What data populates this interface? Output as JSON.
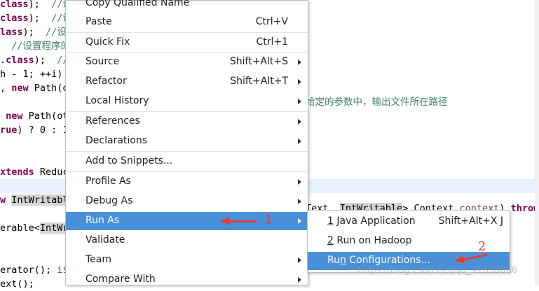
{
  "editor": {
    "lines": [
      [
        {
          "t": "class",
          "c": "kw"
        },
        {
          "t": ");  "
        },
        {
          "t": "//设",
          "c": "cm"
        }
      ],
      [
        {
          "t": "class",
          "c": "kw"
        },
        {
          "t": ");  "
        },
        {
          "t": "//设",
          "c": "cm"
        }
      ],
      [
        {
          "t": "lass",
          "c": "kw"
        },
        {
          "t": ");  "
        },
        {
          "t": "//设",
          "c": "cm"
        }
      ],
      [
        {
          "t": "  "
        },
        {
          "t": "//设置程序的输",
          "c": "cm"
        }
      ],
      [
        {
          "t": "."
        },
        {
          "t": "class",
          "c": "kw"
        },
        {
          "t": ");  "
        },
        {
          "t": "//",
          "c": "cm"
        }
      ],
      [
        {
          "t": "h - 1; ++i)"
        }
      ],
      [
        {
          "t": ", "
        },
        {
          "t": "new",
          "c": "kw"
        },
        {
          "t": " Path(o"
        }
      ],
      [
        {
          "t": ""
        }
      ],
      [
        {
          "t": " "
        },
        {
          "t": "new",
          "c": "kw"
        },
        {
          "t": " Path(ot"
        }
      ],
      [
        {
          "t": "rue",
          "c": "kw"
        },
        {
          "t": ") ? 0 : 1"
        }
      ],
      [
        {
          "t": ""
        }
      ],
      [
        {
          "t": ""
        }
      ],
      [
        {
          "t": "xtends",
          "c": "kw"
        },
        {
          "t": " Reduc"
        }
      ],
      [
        {
          "t": ""
        }
      ],
      [
        {
          "t": "w",
          "c": "kw"
        },
        {
          "t": " "
        },
        {
          "t": "IntWritabl",
          "c": "hlw"
        }
      ],
      [
        {
          "t": ""
        }
      ],
      [
        {
          "t": "erable<"
        },
        {
          "t": "IntWr",
          "c": "hlw"
        }
      ],
      [
        {
          "t": ""
        }
      ],
      [
        {
          "t": ""
        }
      ],
      [
        {
          "t": "erator(); "
        },
        {
          "t": "i$",
          "c": "vr"
        }
      ],
      [
        {
          "t": "ext();"
        }
      ]
    ],
    "right_fragments": [
      {
        "id": "comment",
        "parts": [
          {
            "t": "给定的参数中，输出文件所在路径",
            "c": "cm"
          }
        ]
      },
      {
        "id": "signature",
        "parts": [
          {
            "t": "Text, "
          },
          {
            "t": "IntWritable",
            "c": "hlw"
          },
          {
            "t": "> Context "
          },
          {
            "t": "context",
            "c": "vr"
          },
          {
            "t": ") "
          },
          {
            "t": "throws",
            "c": "kw"
          }
        ]
      }
    ]
  },
  "context_menu": {
    "items": [
      {
        "label": "Copy Qualified Name",
        "shortcut": "",
        "submenu": false
      },
      {
        "label": "Paste",
        "shortcut": "Ctrl+V",
        "submenu": false
      },
      {
        "label": "Quick Fix",
        "shortcut": "Ctrl+1",
        "submenu": false
      },
      {
        "label": "Source",
        "shortcut": "Shift+Alt+S",
        "submenu": true
      },
      {
        "label": "Refactor",
        "shortcut": "Shift+Alt+T",
        "submenu": true
      },
      {
        "label": "Local History",
        "shortcut": "",
        "submenu": true
      },
      {
        "label": "References",
        "shortcut": "",
        "submenu": true
      },
      {
        "label": "Declarations",
        "shortcut": "",
        "submenu": true
      },
      {
        "label": "Add to Snippets...",
        "shortcut": "",
        "submenu": false
      },
      {
        "label": "Profile As",
        "shortcut": "",
        "submenu": true
      },
      {
        "label": "Debug As",
        "shortcut": "",
        "submenu": true
      },
      {
        "label": "Run As",
        "shortcut": "",
        "submenu": true,
        "highlighted": true
      },
      {
        "label": "Validate",
        "shortcut": "",
        "submenu": false
      },
      {
        "label": "Team",
        "shortcut": "",
        "submenu": true
      },
      {
        "label": "Compare With",
        "shortcut": "",
        "submenu": true
      }
    ]
  },
  "run_as_submenu": {
    "items": [
      {
        "mnemonic": "1",
        "label": " Java Application",
        "shortcut": "Shift+Alt+X J"
      },
      {
        "mnemonic": "2",
        "label": " Run on Hadoop",
        "shortcut": ""
      },
      {
        "pre": "Ru",
        "mnemonic": "n",
        "label": " Configurations...",
        "shortcut": "",
        "highlighted": true
      }
    ]
  },
  "annotations": {
    "one": "1",
    "two": "2"
  },
  "watermark": "https://blog.csdn.net/qq_41630866",
  "colors": {
    "menu_highlight": "#4a90d9",
    "annotation_red": "#e53935",
    "keyword": "#7f0055",
    "comment": "#3f7f5f"
  }
}
